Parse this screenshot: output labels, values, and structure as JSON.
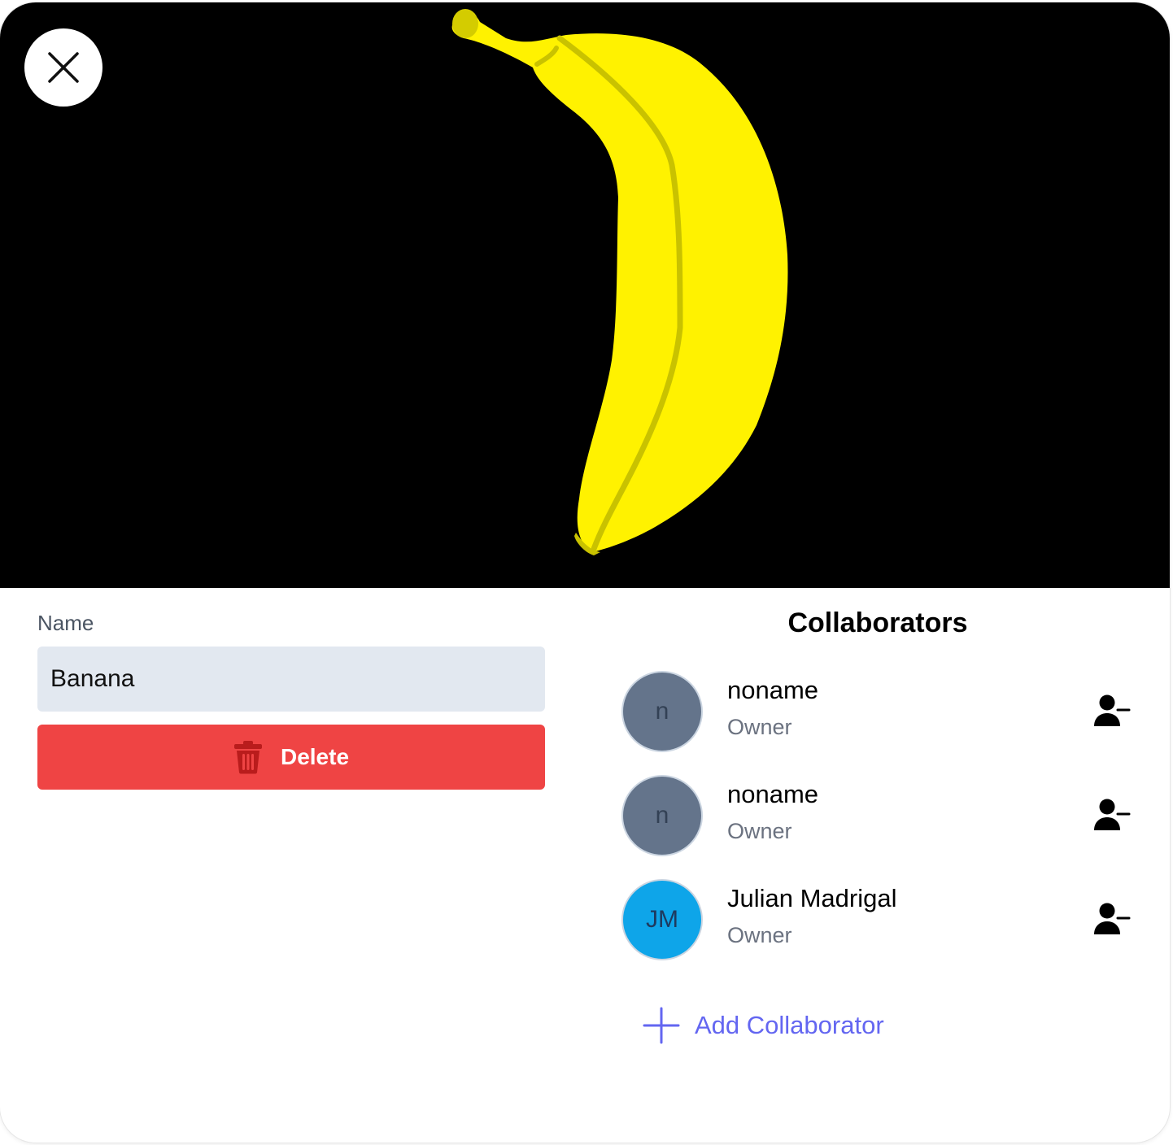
{
  "drawing": {
    "background": "#000000",
    "fill_color": "#fff200",
    "line_color": "#c9c200"
  },
  "close_button": {
    "icon": "close-icon"
  },
  "form": {
    "name_label": "Name",
    "name_value": "Banana",
    "delete_label": "Delete",
    "delete_icon": "trash-icon"
  },
  "collaborators": {
    "title": "Collaborators",
    "items": [
      {
        "initials": "n",
        "name": "noname",
        "role": "Owner",
        "avatar_color": "#64748b",
        "initials_color": "#334155"
      },
      {
        "initials": "n",
        "name": "noname",
        "role": "Owner",
        "avatar_color": "#64748b",
        "initials_color": "#334155"
      },
      {
        "initials": "JM",
        "name": "Julian Madrigal",
        "role": "Owner",
        "avatar_color": "#0ea5e9",
        "initials_color": "#1e3a5f"
      }
    ],
    "remove_icon": "user-minus-icon",
    "add_label": "Add Collaborator",
    "add_icon": "plus-icon",
    "accent_color": "#6366f1"
  },
  "colors": {
    "delete_bg": "#ef4444",
    "input_bg": "#e2e8f0"
  }
}
